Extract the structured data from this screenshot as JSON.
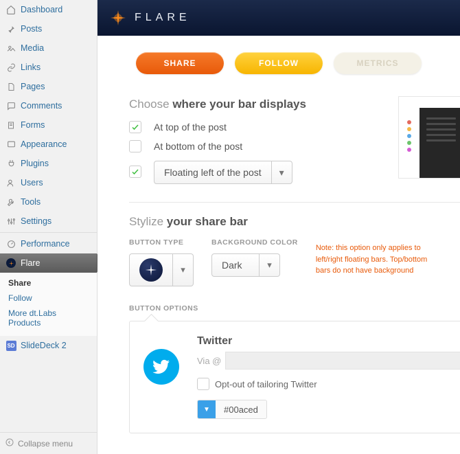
{
  "sidebar": {
    "items": [
      {
        "icon": "home-icon",
        "label": "Dashboard"
      },
      {
        "icon": "pin-icon",
        "label": "Posts"
      },
      {
        "icon": "media-icon",
        "label": "Media"
      },
      {
        "icon": "link-icon",
        "label": "Links"
      },
      {
        "icon": "page-icon",
        "label": "Pages"
      },
      {
        "icon": "comment-icon",
        "label": "Comments"
      },
      {
        "icon": "doc-icon",
        "label": "Forms"
      },
      {
        "icon": "appearance-icon",
        "label": "Appearance"
      },
      {
        "icon": "plugin-icon",
        "label": "Plugins"
      },
      {
        "icon": "users-icon",
        "label": "Users"
      },
      {
        "icon": "tools-icon",
        "label": "Tools"
      },
      {
        "icon": "settings-icon",
        "label": "Settings"
      },
      {
        "icon": "performance-icon",
        "label": "Performance"
      },
      {
        "icon": "flare-icon",
        "label": "Flare"
      },
      {
        "icon": "slidedeck-icon",
        "label": "SlideDeck 2"
      }
    ],
    "submenu": [
      {
        "label": "Share",
        "current": true
      },
      {
        "label": "Follow",
        "current": false
      },
      {
        "label": "More dt.Labs Products",
        "current": false
      }
    ],
    "collapse_label": "Collapse menu"
  },
  "header": {
    "brand": "FLARE"
  },
  "tabs": {
    "share": "SHARE",
    "follow": "FOLLOW",
    "metrics": "METRICS"
  },
  "display": {
    "title_lead": "Choose ",
    "title_strong": "where your bar displays",
    "options": [
      {
        "label": "At top of the post",
        "checked": true
      },
      {
        "label": "At bottom of the post",
        "checked": false
      },
      {
        "label": "Floating left of the post",
        "checked": true,
        "is_select": true
      }
    ]
  },
  "stylize": {
    "title_lead": "Stylize ",
    "title_strong": "your share bar",
    "button_type_label": "BUTTON TYPE",
    "background_label": "BACKGROUND COLOR",
    "background_value": "Dark",
    "note": "Note: this option only applies to left/right floating bars. Top/bottom bars do not have background"
  },
  "options": {
    "section_label": "BUTTON OPTIONS",
    "service": "Twitter",
    "via_label": "Via @",
    "via_value": "",
    "optout_label": "Opt-out of tailoring Twitter",
    "color_value": "#00aced"
  },
  "preview_dots": [
    "#e46a5e",
    "#f5b945",
    "#5aa9e6",
    "#6cc46c",
    "#d45bd4"
  ]
}
